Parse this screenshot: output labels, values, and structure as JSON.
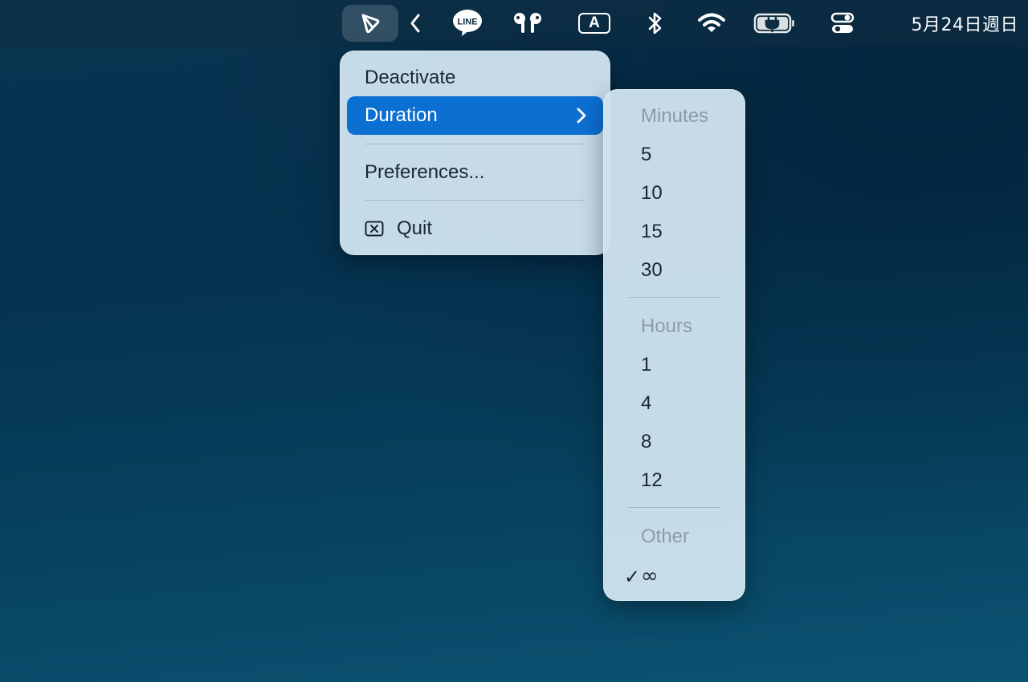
{
  "menubar": {
    "clock": "5月24日週日",
    "input_source_label": "A",
    "line_label": "LINE",
    "icons": [
      "amphetamine-app-icon",
      "chevron-left-icon",
      "line-app-icon",
      "airpods-icon",
      "input-source-icon",
      "bluetooth-icon",
      "wifi-icon",
      "battery-charging-icon",
      "control-center-icon"
    ]
  },
  "main_menu": {
    "items": [
      {
        "label": "Deactivate"
      },
      {
        "label": "Duration",
        "highlighted": true,
        "has_submenu": true
      },
      {
        "label": "Preferences..."
      },
      {
        "label": "Quit",
        "icon": "quit-icon"
      }
    ]
  },
  "duration_submenu": {
    "minutes_header": "Minutes",
    "minutes": [
      "5",
      "10",
      "15",
      "30"
    ],
    "hours_header": "Hours",
    "hours": [
      "1",
      "4",
      "8",
      "12"
    ],
    "other_header": "Other",
    "other": [
      {
        "label": "∞",
        "checked": true,
        "check_mark": "✓"
      }
    ]
  },
  "colors": {
    "highlight": "#0c6fd2",
    "menu_background": "#cee2ee",
    "header_text": "#8e9ba6",
    "desktop": "#05324f"
  }
}
